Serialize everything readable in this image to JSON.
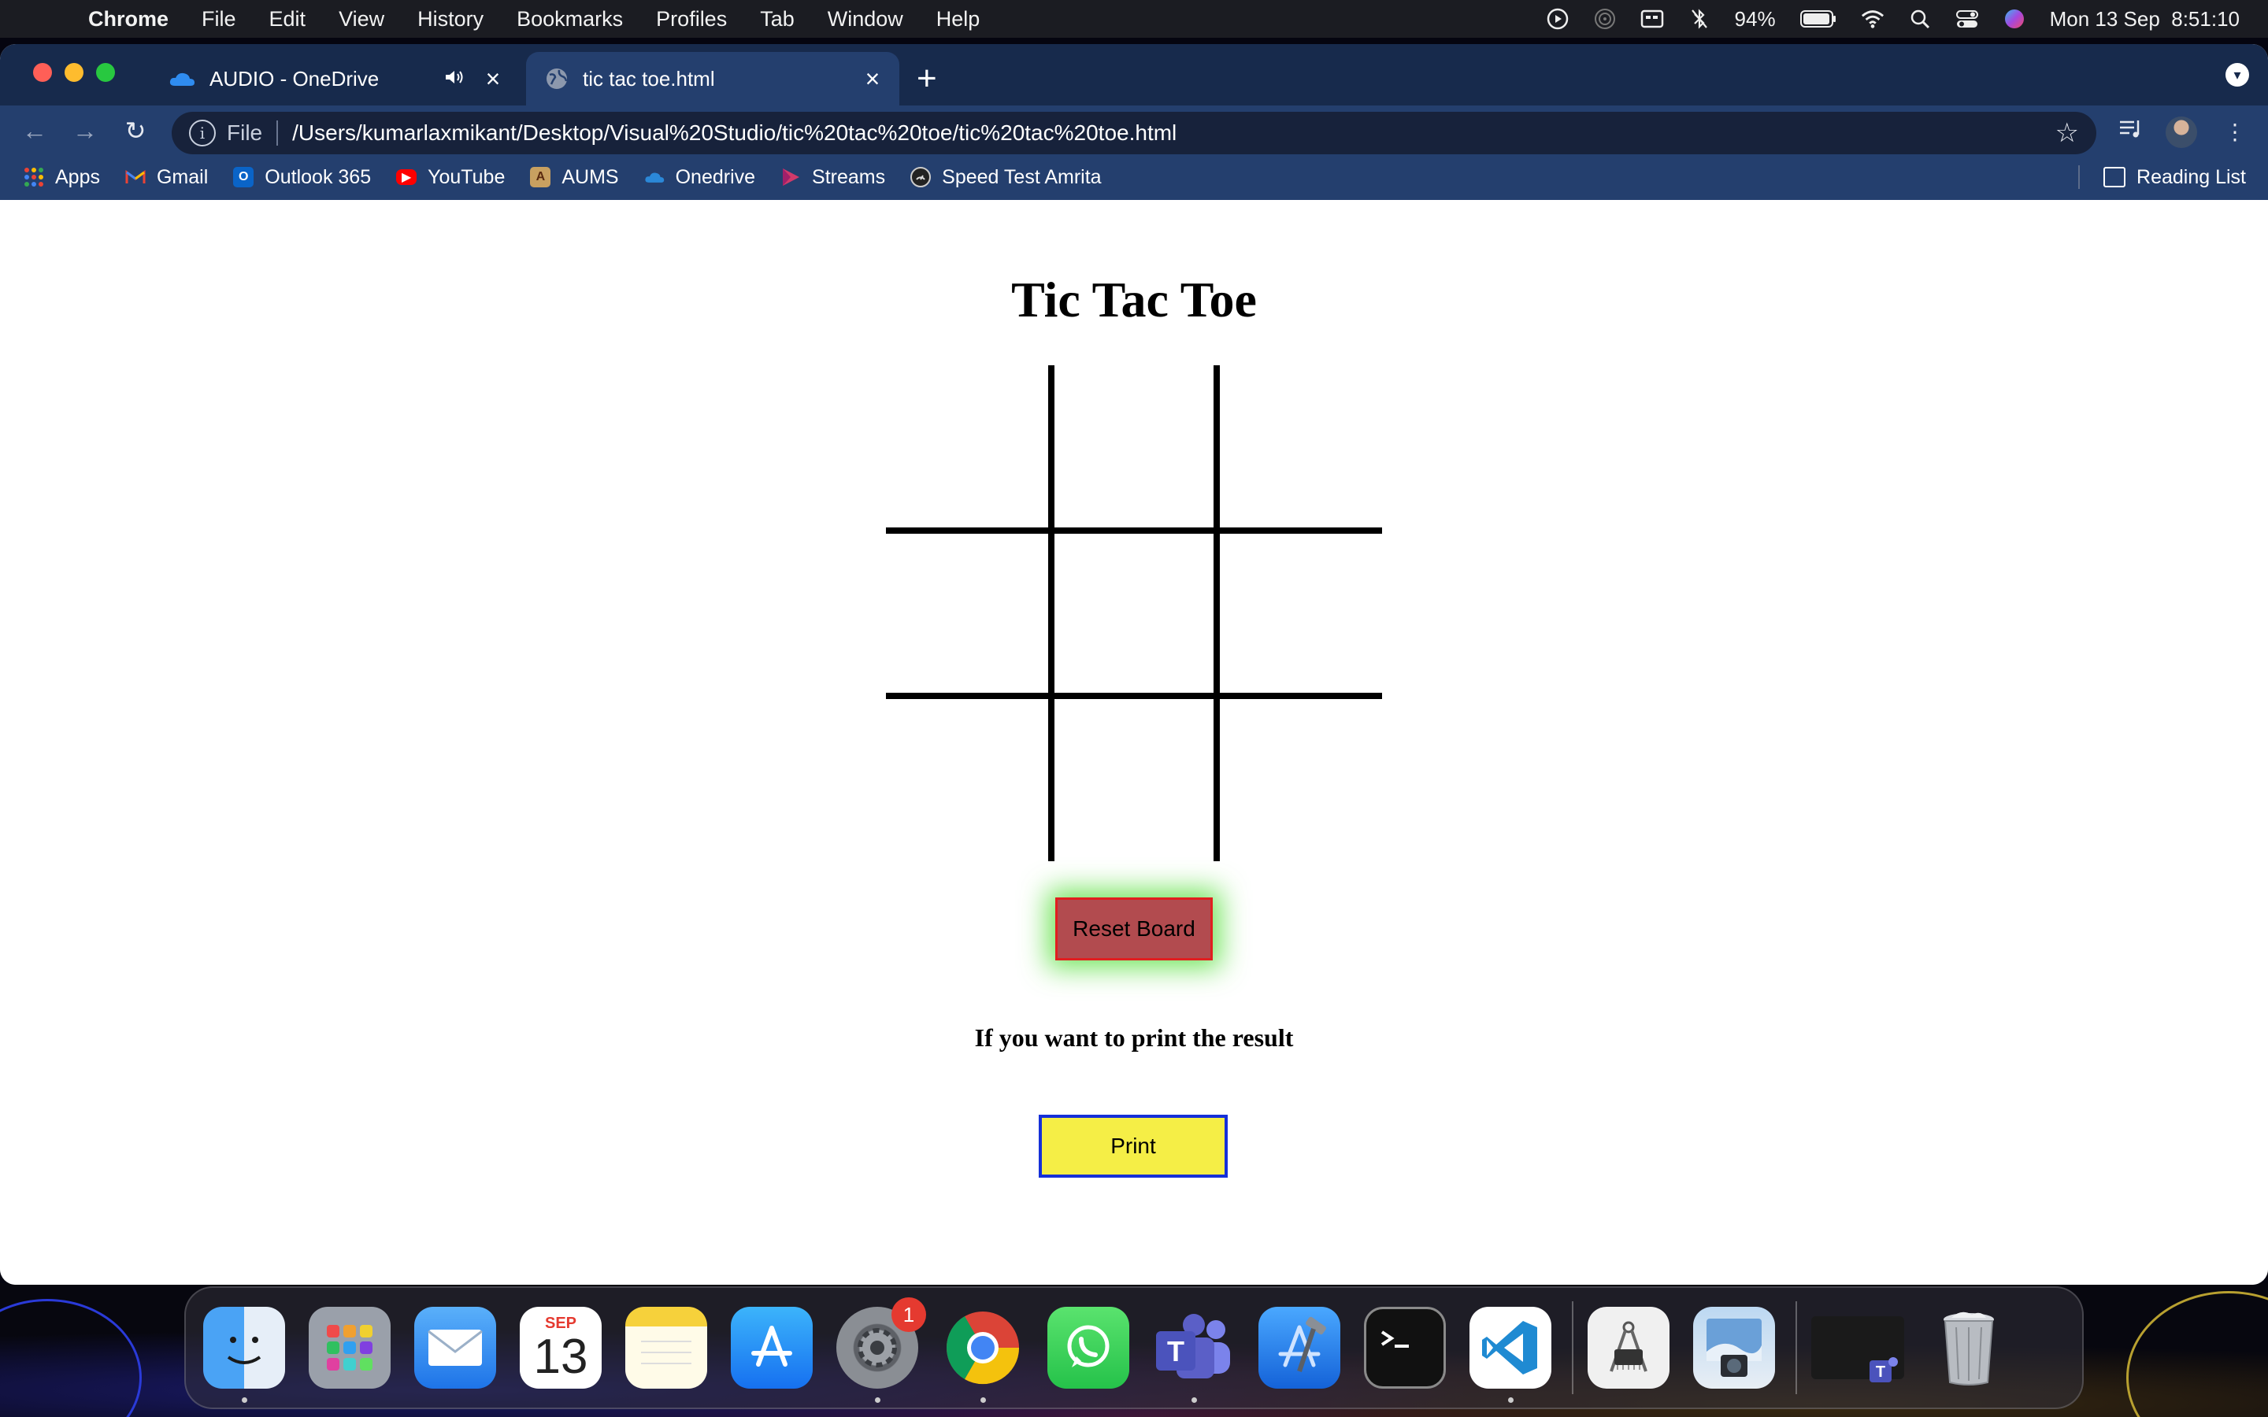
{
  "menubar": {
    "items": [
      "Chrome",
      "File",
      "Edit",
      "View",
      "History",
      "Bookmarks",
      "Profiles",
      "Tab",
      "Window",
      "Help"
    ],
    "battery": "94%",
    "datetime": "Mon 13 Sep  8:51:10"
  },
  "tabs": [
    {
      "label": "AUDIO - OneDrive",
      "icon": "onedrive-cloud-icon",
      "audio": true
    },
    {
      "label": "tic tac toe.html",
      "icon": "globe-icon",
      "active": true
    }
  ],
  "omnibox": {
    "scheme": "File",
    "url": "/Users/kumarlaxmikant/Desktop/Visual%20Studio/tic%20tac%20toe/tic%20tac%20toe.html"
  },
  "bookmarks": {
    "items": [
      {
        "label": "Apps",
        "color": "#e8e8e8"
      },
      {
        "label": "Gmail",
        "color": "#ea4335"
      },
      {
        "label": "Outlook 365",
        "color": "#0a64c8"
      },
      {
        "label": "YouTube",
        "color": "#ff0000"
      },
      {
        "label": "AUMS",
        "color": "#c8a060"
      },
      {
        "label": "Onedrive",
        "color": "#2b88d8"
      },
      {
        "label": "Streams",
        "color": "#d13a6a"
      },
      {
        "label": "Speed Test Amrita",
        "color": "#222222"
      }
    ],
    "reading_list": "Reading List"
  },
  "page": {
    "title": "Tic Tac Toe",
    "board": [
      "",
      "",
      "",
      "",
      "",
      "",
      "",
      "",
      ""
    ],
    "reset_label": "Reset Board",
    "print_note": "If you want to print the result",
    "print_label": "Print"
  },
  "dock": {
    "items": [
      {
        "name": "finder",
        "color": "#3a8ef0"
      },
      {
        "name": "launchpad",
        "color": "#9aa0aa"
      },
      {
        "name": "mail",
        "color": "#2f8ff5"
      },
      {
        "name": "calendar",
        "color": "#ffffff",
        "month": "SEP",
        "day": "13"
      },
      {
        "name": "notes",
        "color": "#f6d13b"
      },
      {
        "name": "app-store",
        "color": "#1b8df5"
      },
      {
        "name": "system-preferences",
        "color": "#7c7f86",
        "badge": "1"
      },
      {
        "name": "chrome",
        "color": "#ffffff"
      },
      {
        "name": "whatsapp",
        "color": "#25d366"
      },
      {
        "name": "teams",
        "color": "#5b5fc7"
      },
      {
        "name": "xcode",
        "color": "#1c7cf0"
      },
      {
        "name": "terminal",
        "color": "#111111"
      },
      {
        "name": "vscode",
        "color": "#ffffff"
      },
      {
        "name": "system-information",
        "color": "#e8e8e8"
      },
      {
        "name": "preview",
        "color": "#9fc3e8"
      },
      {
        "name": "minimized-teams-window",
        "color": "#222222"
      },
      {
        "name": "trash",
        "color": "#b8bcc2"
      }
    ]
  }
}
